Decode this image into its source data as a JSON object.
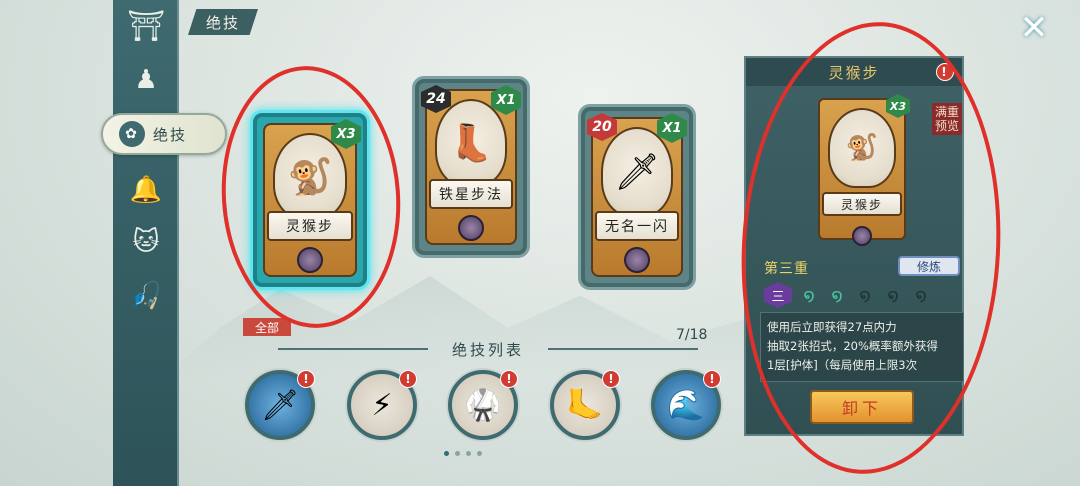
{
  "header": {
    "title": "绝技"
  },
  "nav": {
    "items": [
      {
        "icon": "pavilion-icon"
      },
      {
        "icon": "warrior-icon"
      },
      {
        "icon": "skill-icon",
        "label": "绝技"
      },
      {
        "icon": "bell-icon"
      },
      {
        "icon": "cat-icon"
      },
      {
        "icon": "fishing-icon"
      }
    ]
  },
  "cards": [
    {
      "name": "灵猴步",
      "multiplier": "X3",
      "level": "",
      "selected": true
    },
    {
      "name": "铁星步法",
      "multiplier": "X1",
      "level": "24",
      "selected": false
    },
    {
      "name": "无名一闪",
      "multiplier": "X1",
      "level": "20",
      "selected": false
    }
  ],
  "filter": {
    "label": "全部"
  },
  "list": {
    "title": "绝技列表",
    "count": "7/18"
  },
  "skill_list": [
    {
      "icon": "blade-icon",
      "alert": "!"
    },
    {
      "icon": "slash-icon",
      "alert": "!"
    },
    {
      "icon": "spear-fighter-icon",
      "alert": "!"
    },
    {
      "icon": "kick-icon",
      "alert": "!"
    },
    {
      "icon": "wave-palm-icon",
      "alert": "!"
    }
  ],
  "panel": {
    "title": "灵猴步",
    "alert": "!",
    "card_name": "灵猴步",
    "card_multiplier": "X3",
    "max_preview": "满重预览",
    "tier_label": "第三重",
    "tier_badge": "三",
    "train_button": "修炼",
    "desc_lines": [
      "使用后立即获得27点内力",
      "抽取2张招式，20%概率额外获得",
      "1层[护体]（每局使用上限3次"
    ],
    "unequip_button": "卸下"
  },
  "close": {
    "label": "✕"
  },
  "colors": {
    "annotation": "#e0302a",
    "selected_glow": "#48e2ee"
  }
}
